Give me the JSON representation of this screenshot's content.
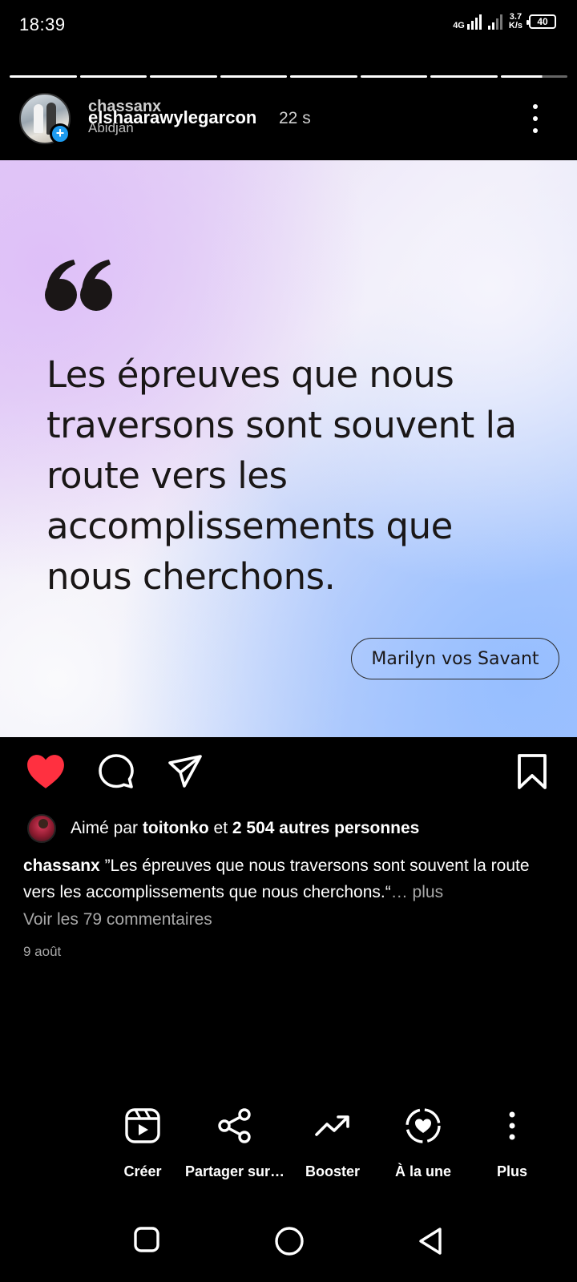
{
  "status_bar": {
    "time": "18:39",
    "network": "4G",
    "speed_value": "3.7",
    "speed_unit": "K/s",
    "battery": "40"
  },
  "story": {
    "segments": 8,
    "current_segment_progress": 0.6
  },
  "header": {
    "username_overlay": "chassanx",
    "username": "elshaarawylegarcon",
    "location": "Abidjan",
    "time_ago": "22 s",
    "add_badge": "+"
  },
  "card": {
    "quote": "Les épreuves que nous traversons sont souvent la route vers les accomplissements que nous cherchons.",
    "author": "Marilyn vos Savant"
  },
  "actions": {
    "like_icon": "heart-filled-icon",
    "comment_icon": "comment-icon",
    "share_icon": "send-icon",
    "save_icon": "bookmark-icon",
    "like_color": "#ff3040"
  },
  "meta": {
    "likes_prefix": "Aimé par",
    "likes_user": "toitonko",
    "likes_middle": "et",
    "likes_count": "2 504 autres personnes",
    "caption_user": "chassanx",
    "caption_text": " ”Les épreuves que nous traversons sont souvent la route vers les accomplissements que nous cherchons.“",
    "caption_more": "… plus",
    "comments_link": "Voir les 79 commentaires",
    "date": "9 août"
  },
  "tools": [
    {
      "label": "Créer",
      "icon": "reels-icon"
    },
    {
      "label": "Partager sur…",
      "icon": "share-nodes-icon"
    },
    {
      "label": "Booster",
      "icon": "trending-up-icon"
    },
    {
      "label": "À la une",
      "icon": "highlight-heart-icon"
    },
    {
      "label": "Plus",
      "icon": "more-vertical-icon"
    }
  ],
  "navbar": [
    "recents-icon",
    "home-icon",
    "back-icon"
  ]
}
